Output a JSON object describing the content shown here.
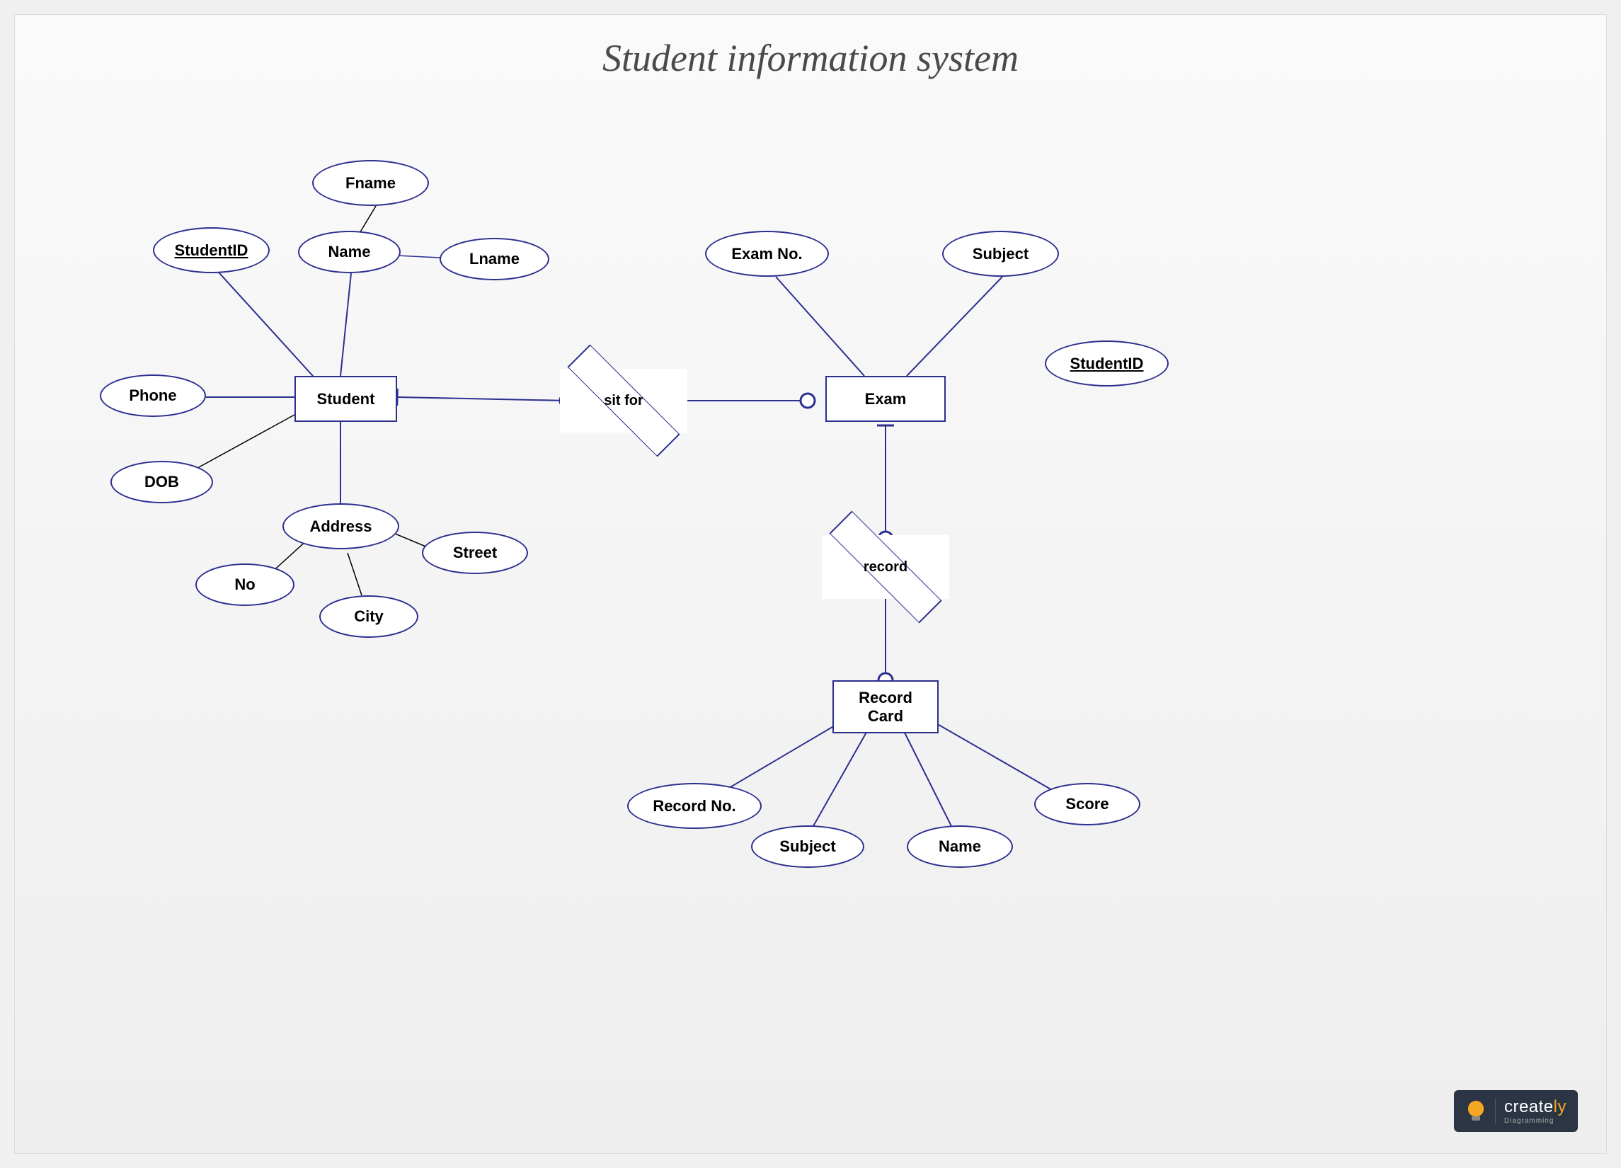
{
  "title": "Student information system",
  "entities": {
    "student": "Student",
    "exam": "Exam",
    "record_card": "Record\nCard"
  },
  "relationships": {
    "sit_for": "sit for",
    "record": "record"
  },
  "attributes": {
    "student_id": "StudentID",
    "fname": "Fname",
    "lname": "Lname",
    "name": "Name",
    "phone": "Phone",
    "dob": "DOB",
    "address": "Address",
    "no": "No",
    "city": "City",
    "street": "Street",
    "exam_no": "Exam No.",
    "subject": "Subject",
    "student_id_2": "StudentID",
    "record_no": "Record No.",
    "rc_subject": "Subject",
    "rc_name": "Name",
    "score": "Score"
  },
  "logo": {
    "brand": "create",
    "suffix": "ly",
    "tagline": "Diagramming"
  },
  "edges": [
    {
      "from": "student",
      "to": "student_id"
    },
    {
      "from": "student",
      "to": "name"
    },
    {
      "from": "name",
      "to": "fname"
    },
    {
      "from": "name",
      "to": "lname"
    },
    {
      "from": "student",
      "to": "phone"
    },
    {
      "from": "student",
      "to": "dob"
    },
    {
      "from": "student",
      "to": "address"
    },
    {
      "from": "address",
      "to": "no"
    },
    {
      "from": "address",
      "to": "city"
    },
    {
      "from": "address",
      "to": "street"
    },
    {
      "from": "student",
      "to": "sit_for",
      "cardinality": "one-or-many"
    },
    {
      "from": "sit_for",
      "to": "exam",
      "cardinality": "one-or-many"
    },
    {
      "from": "exam",
      "to": "exam_no"
    },
    {
      "from": "exam",
      "to": "subject"
    },
    {
      "from": "exam",
      "to": "record",
      "cardinality": "one-or-many"
    },
    {
      "from": "record",
      "to": "record_card",
      "cardinality": "one-or-many"
    },
    {
      "from": "record_card",
      "to": "record_no"
    },
    {
      "from": "record_card",
      "to": "rc_subject"
    },
    {
      "from": "record_card",
      "to": "rc_name"
    },
    {
      "from": "record_card",
      "to": "score"
    }
  ]
}
